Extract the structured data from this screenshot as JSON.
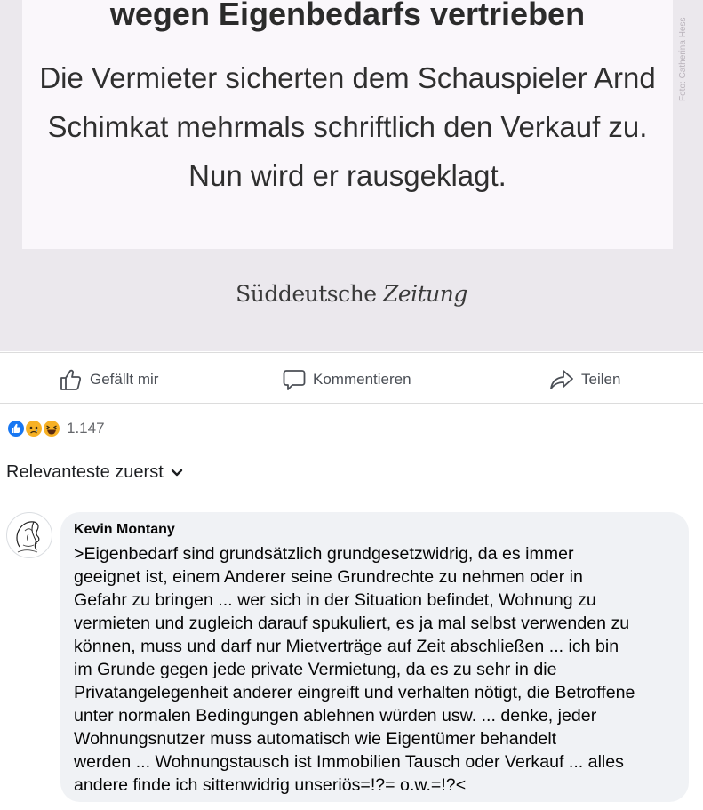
{
  "post_image": {
    "headline": "wegen Eigenbedarfs vertrieben",
    "body": "Die Vermieter sicherten dem Schauspieler Arnd Schimkat mehrmals schriftlich den Verkauf zu. Nun wird er rausgeklagt.",
    "photo_credit": "Foto: Catherina Hess",
    "logo_part1": "Süddeutsche ",
    "logo_part2": "Zeitung"
  },
  "actions": {
    "like_label": "Gefällt mir",
    "comment_label": "Kommentieren",
    "share_label": "Teilen"
  },
  "reactions": {
    "icons": [
      "like-icon",
      "sad-icon",
      "haha-icon"
    ],
    "count": "1.147"
  },
  "sort": {
    "label": "Relevanteste zuerst",
    "icon": "chevron-down-icon"
  },
  "comment": {
    "author": "Kevin Montany",
    "text": ">Eigenbedarf sind grundsätzlich grundgesetzwidrig, da es immer\ngeeignet ist, einem  Anderer seine Grundrechte zu nehmen oder in\nGefahr zu bringen ... wer sich in der Situation befindet, Wohnung zu\nvermieten und zugleich darauf spukuliert, es ja mal selbst verwenden zu\nkönnen, muss und darf nur Mietverträge auf Zeit abschließen ... ich bin\nim Grunde gegen jede private Vermietung, da es zu sehr in die\nPrivatangelegenheit anderer eingreift und verhalten nötigt, die Betroffene\nunter normalen Bedingungen ablehnen würden  usw. ... denke, jeder\nWohnungsnutzer muss automatisch wie Eigentümer behandelt\nwerden ... Wohnungstausch ist Immobilien Tausch oder Verkauf ... alles\nandere finde ich sittenwidrig unseriös=!?= o.w.=!?<"
  },
  "colors": {
    "like_blue": "#1877f2",
    "reaction_yellow": "#f7b125",
    "bubble_bg": "#f0f2f5",
    "image_bg": "#ebe8ed"
  }
}
